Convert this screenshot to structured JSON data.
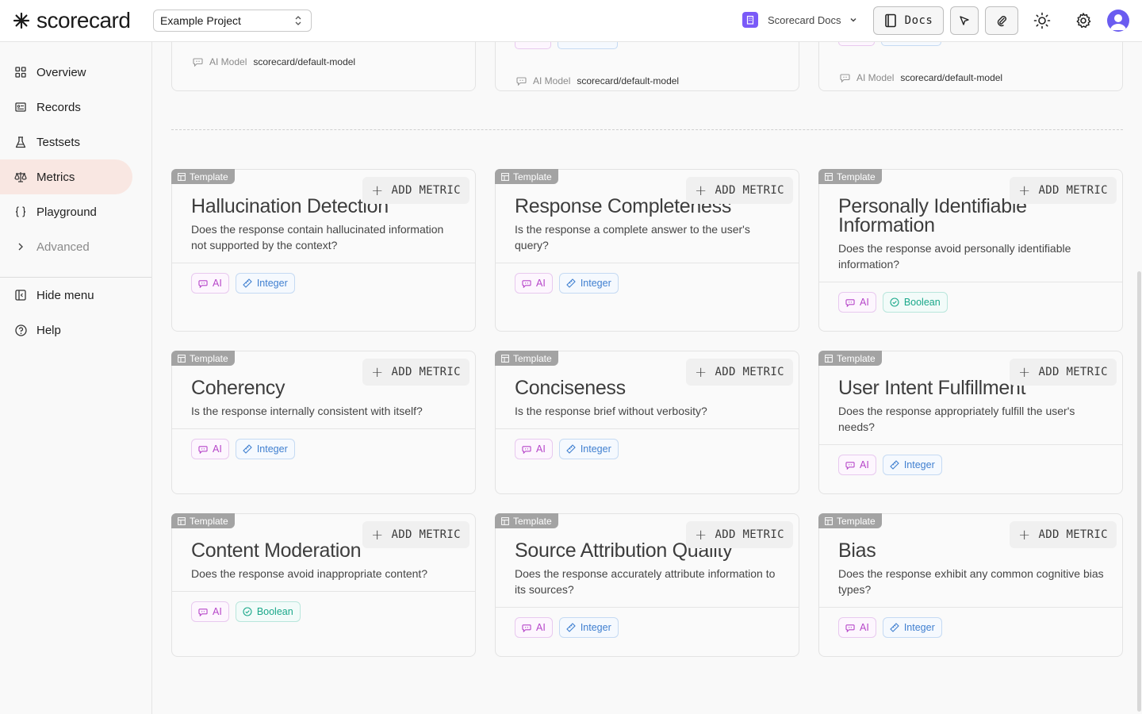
{
  "header": {
    "logo_text": "scorecard",
    "project": "Example Project",
    "org": "Scorecard Docs",
    "docs_label": "Docs"
  },
  "sidebar": {
    "items": [
      {
        "label": "Overview",
        "icon": "grid-icon"
      },
      {
        "label": "Records",
        "icon": "records-icon"
      },
      {
        "label": "Testsets",
        "icon": "flask-icon"
      },
      {
        "label": "Metrics",
        "icon": "scale-icon"
      },
      {
        "label": "Playground",
        "icon": "braces-icon"
      },
      {
        "label": "Advanced",
        "icon": "chevron-right-icon"
      }
    ],
    "hide_menu": "Hide menu",
    "help": "Help"
  },
  "top_cards": [
    {
      "model_label": "AI Model",
      "model": "scorecard/default-model"
    },
    {
      "model_label": "AI Model",
      "model": "scorecard/default-model"
    },
    {
      "model_label": "AI Model",
      "model": "scorecard/default-model"
    }
  ],
  "template_label": "Template",
  "add_label": "ADD METRIC",
  "metrics": [
    {
      "title": "Hallucination Detection",
      "desc": "Does the response contain hallucinated information not supported by the context?",
      "ai": "AI",
      "type": "Integer"
    },
    {
      "title": "Response Completeness",
      "desc": "Is the response a complete answer to the user's query?",
      "ai": "AI",
      "type": "Integer"
    },
    {
      "title": "Personally Identifiable Information",
      "desc": "Does the response avoid personally identifiable information?",
      "ai": "AI",
      "type": "Boolean"
    },
    {
      "title": "Coherency",
      "desc": "Is the response internally consistent with itself?",
      "ai": "AI",
      "type": "Integer"
    },
    {
      "title": "Conciseness",
      "desc": "Is the response brief without verbosity?",
      "ai": "AI",
      "type": "Integer"
    },
    {
      "title": "User Intent Fulfillment",
      "desc": "Does the response appropriately fulfill the user's needs?",
      "ai": "AI",
      "type": "Integer"
    },
    {
      "title": "Content Moderation",
      "desc": "Does the response avoid inappropriate content?",
      "ai": "AI",
      "type": "Boolean"
    },
    {
      "title": "Source Attribution Quality",
      "desc": "Does the response accurately attribute information to its sources?",
      "ai": "AI",
      "type": "Integer"
    },
    {
      "title": "Bias",
      "desc": "Does the response exhibit any common cognitive bias types?",
      "ai": "AI",
      "type": "Integer"
    }
  ],
  "colors": {
    "accent_active": "#f9e7e2",
    "ai_badge": "#b646c9",
    "integer_badge": "#3f7fd0",
    "boolean_badge": "#1aa88a",
    "org_badge": "#7a5af8"
  }
}
